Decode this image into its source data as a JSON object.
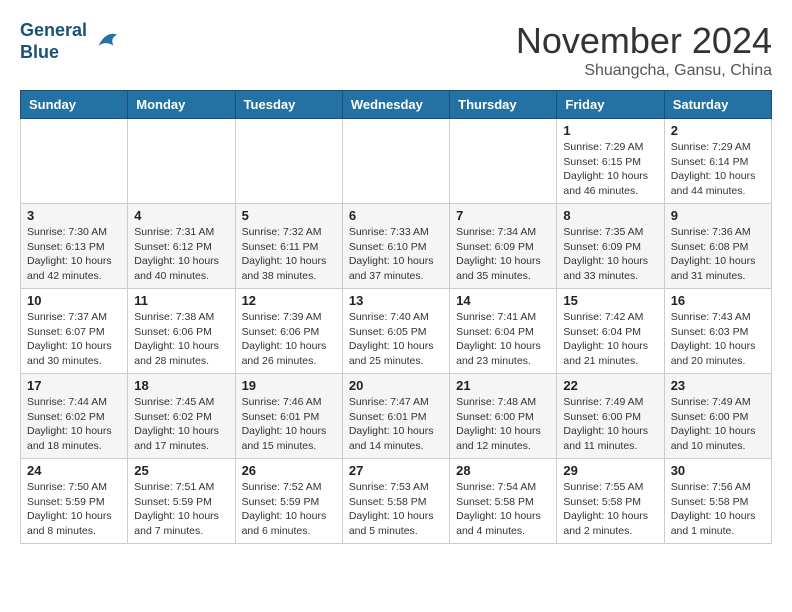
{
  "header": {
    "logo_line1": "General",
    "logo_line2": "Blue",
    "month_title": "November 2024",
    "location": "Shuangcha, Gansu, China"
  },
  "weekdays": [
    "Sunday",
    "Monday",
    "Tuesday",
    "Wednesday",
    "Thursday",
    "Friday",
    "Saturday"
  ],
  "weeks": [
    [
      {
        "day": "",
        "info": ""
      },
      {
        "day": "",
        "info": ""
      },
      {
        "day": "",
        "info": ""
      },
      {
        "day": "",
        "info": ""
      },
      {
        "day": "",
        "info": ""
      },
      {
        "day": "1",
        "info": "Sunrise: 7:29 AM\nSunset: 6:15 PM\nDaylight: 10 hours and 46 minutes."
      },
      {
        "day": "2",
        "info": "Sunrise: 7:29 AM\nSunset: 6:14 PM\nDaylight: 10 hours and 44 minutes."
      }
    ],
    [
      {
        "day": "3",
        "info": "Sunrise: 7:30 AM\nSunset: 6:13 PM\nDaylight: 10 hours and 42 minutes."
      },
      {
        "day": "4",
        "info": "Sunrise: 7:31 AM\nSunset: 6:12 PM\nDaylight: 10 hours and 40 minutes."
      },
      {
        "day": "5",
        "info": "Sunrise: 7:32 AM\nSunset: 6:11 PM\nDaylight: 10 hours and 38 minutes."
      },
      {
        "day": "6",
        "info": "Sunrise: 7:33 AM\nSunset: 6:10 PM\nDaylight: 10 hours and 37 minutes."
      },
      {
        "day": "7",
        "info": "Sunrise: 7:34 AM\nSunset: 6:09 PM\nDaylight: 10 hours and 35 minutes."
      },
      {
        "day": "8",
        "info": "Sunrise: 7:35 AM\nSunset: 6:09 PM\nDaylight: 10 hours and 33 minutes."
      },
      {
        "day": "9",
        "info": "Sunrise: 7:36 AM\nSunset: 6:08 PM\nDaylight: 10 hours and 31 minutes."
      }
    ],
    [
      {
        "day": "10",
        "info": "Sunrise: 7:37 AM\nSunset: 6:07 PM\nDaylight: 10 hours and 30 minutes."
      },
      {
        "day": "11",
        "info": "Sunrise: 7:38 AM\nSunset: 6:06 PM\nDaylight: 10 hours and 28 minutes."
      },
      {
        "day": "12",
        "info": "Sunrise: 7:39 AM\nSunset: 6:06 PM\nDaylight: 10 hours and 26 minutes."
      },
      {
        "day": "13",
        "info": "Sunrise: 7:40 AM\nSunset: 6:05 PM\nDaylight: 10 hours and 25 minutes."
      },
      {
        "day": "14",
        "info": "Sunrise: 7:41 AM\nSunset: 6:04 PM\nDaylight: 10 hours and 23 minutes."
      },
      {
        "day": "15",
        "info": "Sunrise: 7:42 AM\nSunset: 6:04 PM\nDaylight: 10 hours and 21 minutes."
      },
      {
        "day": "16",
        "info": "Sunrise: 7:43 AM\nSunset: 6:03 PM\nDaylight: 10 hours and 20 minutes."
      }
    ],
    [
      {
        "day": "17",
        "info": "Sunrise: 7:44 AM\nSunset: 6:02 PM\nDaylight: 10 hours and 18 minutes."
      },
      {
        "day": "18",
        "info": "Sunrise: 7:45 AM\nSunset: 6:02 PM\nDaylight: 10 hours and 17 minutes."
      },
      {
        "day": "19",
        "info": "Sunrise: 7:46 AM\nSunset: 6:01 PM\nDaylight: 10 hours and 15 minutes."
      },
      {
        "day": "20",
        "info": "Sunrise: 7:47 AM\nSunset: 6:01 PM\nDaylight: 10 hours and 14 minutes."
      },
      {
        "day": "21",
        "info": "Sunrise: 7:48 AM\nSunset: 6:00 PM\nDaylight: 10 hours and 12 minutes."
      },
      {
        "day": "22",
        "info": "Sunrise: 7:49 AM\nSunset: 6:00 PM\nDaylight: 10 hours and 11 minutes."
      },
      {
        "day": "23",
        "info": "Sunrise: 7:49 AM\nSunset: 6:00 PM\nDaylight: 10 hours and 10 minutes."
      }
    ],
    [
      {
        "day": "24",
        "info": "Sunrise: 7:50 AM\nSunset: 5:59 PM\nDaylight: 10 hours and 8 minutes."
      },
      {
        "day": "25",
        "info": "Sunrise: 7:51 AM\nSunset: 5:59 PM\nDaylight: 10 hours and 7 minutes."
      },
      {
        "day": "26",
        "info": "Sunrise: 7:52 AM\nSunset: 5:59 PM\nDaylight: 10 hours and 6 minutes."
      },
      {
        "day": "27",
        "info": "Sunrise: 7:53 AM\nSunset: 5:58 PM\nDaylight: 10 hours and 5 minutes."
      },
      {
        "day": "28",
        "info": "Sunrise: 7:54 AM\nSunset: 5:58 PM\nDaylight: 10 hours and 4 minutes."
      },
      {
        "day": "29",
        "info": "Sunrise: 7:55 AM\nSunset: 5:58 PM\nDaylight: 10 hours and 2 minutes."
      },
      {
        "day": "30",
        "info": "Sunrise: 7:56 AM\nSunset: 5:58 PM\nDaylight: 10 hours and 1 minute."
      }
    ]
  ]
}
